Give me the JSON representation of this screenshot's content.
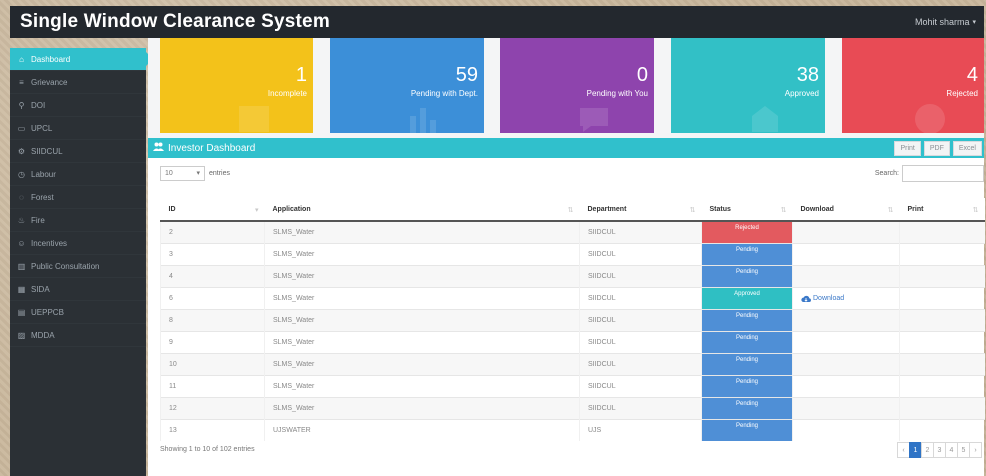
{
  "header": {
    "title": "Single Window Clearance System",
    "user": "Mohit sharma"
  },
  "sidebar": {
    "items": [
      {
        "label": "Dashboard",
        "icon": "home-icon",
        "glyph": "⌂",
        "active": true
      },
      {
        "label": "Grievance",
        "icon": "list-icon",
        "glyph": "≡"
      },
      {
        "label": "DOI",
        "icon": "filter-icon",
        "glyph": "⚲"
      },
      {
        "label": "UPCL",
        "icon": "doc-icon",
        "glyph": "▭"
      },
      {
        "label": "SIIDCUL",
        "icon": "gear-icon",
        "glyph": "⚙"
      },
      {
        "label": "Labour",
        "icon": "clock-icon",
        "glyph": "◷"
      },
      {
        "label": "Forest",
        "icon": "pin-icon",
        "glyph": "◌"
      },
      {
        "label": "Fire",
        "icon": "fire-icon",
        "glyph": "♨"
      },
      {
        "label": "Incentives",
        "icon": "user-icon",
        "glyph": "☺"
      },
      {
        "label": "Public Consultation",
        "icon": "chart-icon",
        "glyph": "▥"
      },
      {
        "label": "SIDA",
        "icon": "grid-icon",
        "glyph": "▦"
      },
      {
        "label": "UEPPCB",
        "icon": "building-icon",
        "glyph": "▤"
      },
      {
        "label": "MDDA",
        "icon": "map-icon",
        "glyph": "▨"
      }
    ]
  },
  "cards": [
    {
      "value": "1",
      "label": "Incomplete",
      "color": "#f3c21a"
    },
    {
      "value": "59",
      "label": "Pending with Dept.",
      "color": "#3c8fd8"
    },
    {
      "value": "0",
      "label": "Pending with You",
      "color": "#8e44ad"
    },
    {
      "value": "38",
      "label": "Approved",
      "color": "#32c0c6"
    },
    {
      "value": "4",
      "label": "Rejected",
      "color": "#e84b55"
    }
  ],
  "panel": {
    "title": "Investor Dashboard",
    "buttons": [
      "Print",
      "PDF",
      "Excel"
    ],
    "length_value": "10",
    "entries_label": "entries",
    "search_label": "Search:"
  },
  "table": {
    "headers": [
      "ID",
      "Application",
      "Department",
      "Status",
      "Download",
      "Print"
    ],
    "rows": [
      {
        "id": "2",
        "app": "SLMS_Water",
        "dept": "SIIDCUL",
        "status": "Rejected",
        "download": ""
      },
      {
        "id": "3",
        "app": "SLMS_Water",
        "dept": "SIIDCUL",
        "status": "Pending",
        "download": ""
      },
      {
        "id": "4",
        "app": "SLMS_Water",
        "dept": "SIIDCUL",
        "status": "Pending",
        "download": ""
      },
      {
        "id": "6",
        "app": "SLMS_Water",
        "dept": "SIIDCUL",
        "status": "Approved",
        "download": "Download"
      },
      {
        "id": "8",
        "app": "SLMS_Water",
        "dept": "SIIDCUL",
        "status": "Pending",
        "download": ""
      },
      {
        "id": "9",
        "app": "SLMS_Water",
        "dept": "SIIDCUL",
        "status": "Pending",
        "download": ""
      },
      {
        "id": "10",
        "app": "SLMS_Water",
        "dept": "SIIDCUL",
        "status": "Pending",
        "download": ""
      },
      {
        "id": "11",
        "app": "SLMS_Water",
        "dept": "SIIDCUL",
        "status": "Pending",
        "download": ""
      },
      {
        "id": "12",
        "app": "SLMS_Water",
        "dept": "SIIDCUL",
        "status": "Pending",
        "download": ""
      },
      {
        "id": "13",
        "app": "UJSWATER",
        "dept": "UJS",
        "status": "Pending",
        "download": ""
      }
    ]
  },
  "footer": {
    "info": "Showing 1 to 10 of 102 entries",
    "pages": [
      "‹",
      "1",
      "2",
      "3",
      "4",
      "5",
      "›"
    ],
    "active_page": "1"
  }
}
